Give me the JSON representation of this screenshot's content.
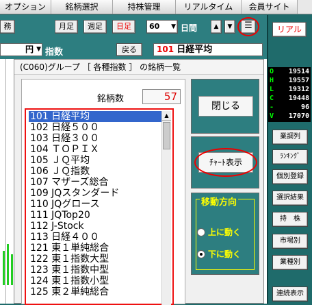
{
  "menu": [
    "オプション",
    "銘柄選択",
    "持株管理",
    "リアルタイム",
    "会員サイト"
  ],
  "toolbar": {
    "left_btn": "務",
    "monthly": "月足",
    "weekly": "週足",
    "daily": "日足",
    "period_value": "60",
    "period_unit": "日間",
    "real": "リアル"
  },
  "row2": {
    "currency": "円",
    "index_label": "指数",
    "back": "戻る",
    "code": "101",
    "name": "日経平均"
  },
  "quotes": [
    {
      "label": "O",
      "value": "19514"
    },
    {
      "label": "H",
      "value": "19557"
    },
    {
      "label": "L",
      "value": "19312"
    },
    {
      "label": "C",
      "value": "19448"
    },
    {
      "label": "-",
      "value": "96"
    },
    {
      "label": "V",
      "value": "17070"
    }
  ],
  "side_buttons": [
    "業調列",
    "ﾗﾝｷﾝｸﾞ",
    "個別登録",
    "選択結果",
    "持　株",
    "市場別",
    "業種別",
    "連続表示"
  ],
  "dialog": {
    "title": "(C060)グループ ［ 各種指数 ］ の銘柄一覧",
    "count_label": "銘柄数",
    "count_value": "57",
    "close": "閉じる",
    "chart": "ﾁｬｰﾄ表示",
    "move_title": "移動方向",
    "up": "上に動く",
    "down": "下に動く",
    "items": [
      "101 日経平均",
      "102 日経５００",
      "103 日経３００",
      "104 ＴＯＰＩＸ",
      "105 ＪＱ平均",
      "106 ＪＱ指数",
      "107 マザーズ総合",
      "109 JQスタンダード",
      "110 JQグロース",
      "111 JQTop20",
      "112 J-Stock",
      "113 日経４００",
      "121 東１単純総合",
      "122 東１指数大型",
      "123 東１指数中型",
      "124 東１指数小型",
      "125 東２単純総合"
    ]
  },
  "colors": {
    "accent_red": "#e00000",
    "panel_teal": "#2d7e80"
  }
}
